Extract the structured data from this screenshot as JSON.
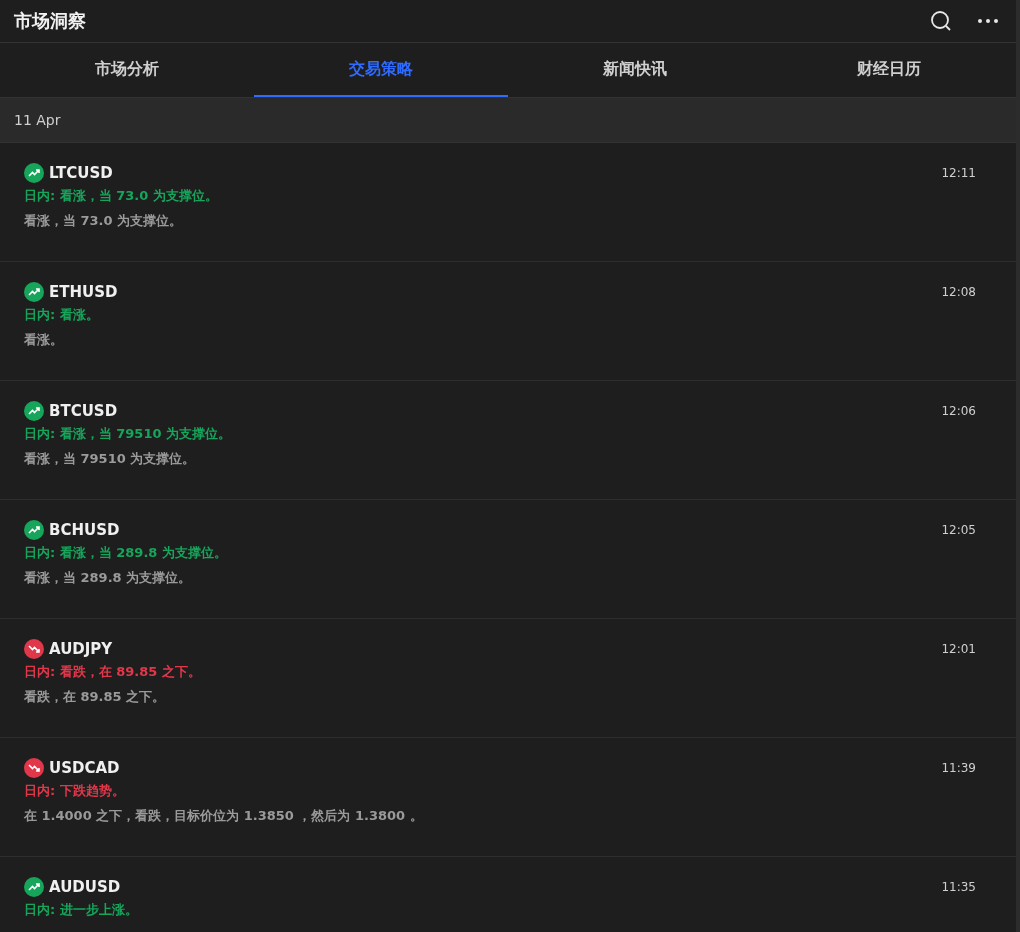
{
  "header": {
    "title": "市场洞察"
  },
  "tabs": [
    {
      "label": "市场分析",
      "selected": false
    },
    {
      "label": "交易策略",
      "selected": true
    },
    {
      "label": "新闻快讯",
      "selected": false
    },
    {
      "label": "财经日历",
      "selected": false
    }
  ],
  "date": "11 Apr",
  "items": [
    {
      "symbol": "LTCUSD",
      "kind": "up",
      "time": "12:11",
      "summary": "日内: 看涨，当 73.0 为支撑位。",
      "detail": "看涨，当 73.0 为支撑位。"
    },
    {
      "symbol": "ETHUSD",
      "kind": "up",
      "time": "12:08",
      "summary": "日内: 看涨。",
      "detail": "看涨。"
    },
    {
      "symbol": "BTCUSD",
      "kind": "up",
      "time": "12:06",
      "summary": "日内: 看涨，当 79510 为支撑位。",
      "detail": "看涨，当 79510 为支撑位。"
    },
    {
      "symbol": "BCHUSD",
      "kind": "up",
      "time": "12:05",
      "summary": "日内: 看涨，当 289.8 为支撑位。",
      "detail": "看涨，当 289.8 为支撑位。"
    },
    {
      "symbol": "AUDJPY",
      "kind": "down",
      "time": "12:01",
      "summary": "日内: 看跌，在 89.85 之下。",
      "detail": "看跌，在 89.85 之下。"
    },
    {
      "symbol": "USDCAD",
      "kind": "down",
      "time": "11:39",
      "summary": "日内: 下跌趋势。",
      "detail": "在 1.4000 之下，看跌，目标价位为 1.3850 ，然后为 1.3800 。"
    },
    {
      "symbol": "AUDUSD",
      "kind": "up",
      "time": "11:35",
      "summary": "日内: 进一步上涨。"
    }
  ]
}
